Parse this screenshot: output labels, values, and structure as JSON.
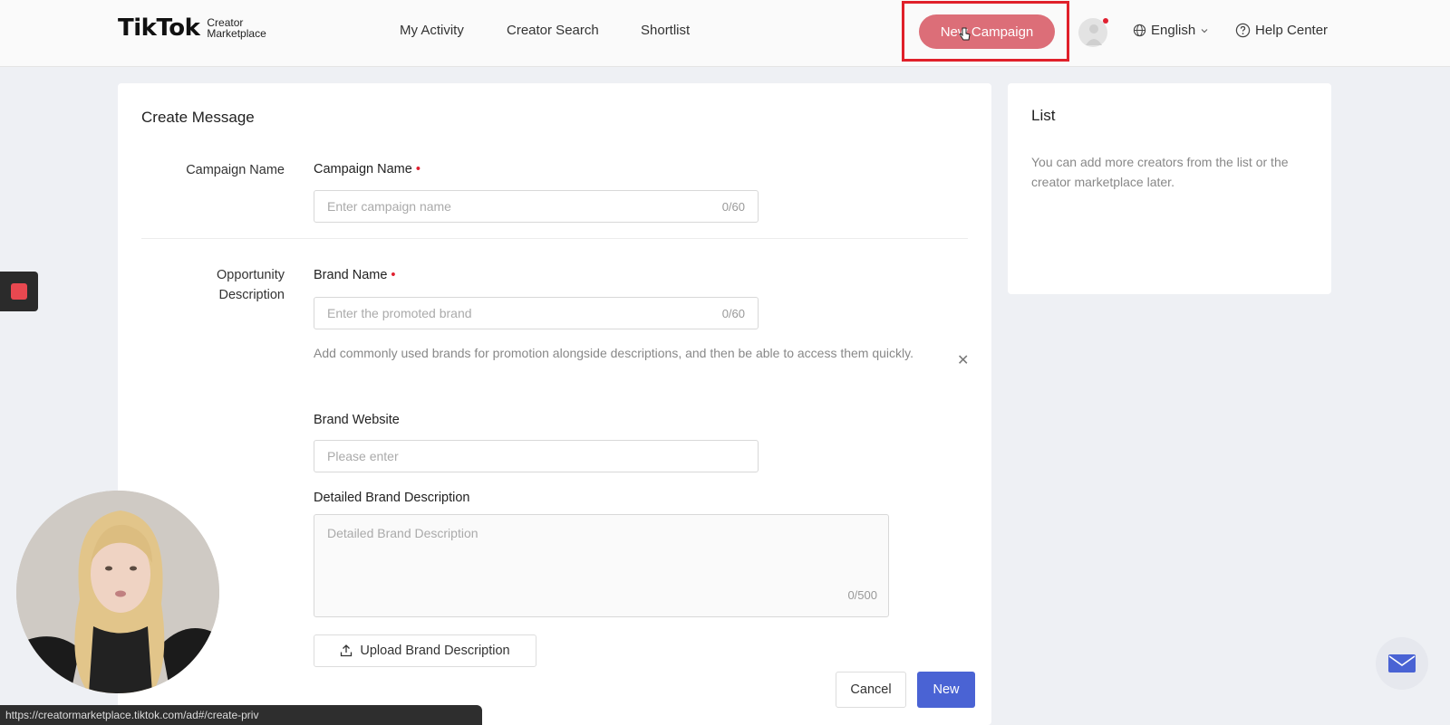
{
  "header": {
    "logo_main": "TikTok",
    "logo_sub_line1": "Creator",
    "logo_sub_line2": "Marketplace",
    "nav": [
      "My Activity",
      "Creator Search",
      "Shortlist"
    ],
    "new_campaign_label": "New Campaign",
    "language": "English",
    "help_label": "Help Center"
  },
  "form": {
    "title": "Create Message",
    "campaign_section_label": "Campaign Name",
    "campaign_name_label": "Campaign Name",
    "campaign_name_placeholder": "Enter campaign name",
    "campaign_name_counter": "0/60",
    "opportunity_label_line1": "Opportunity",
    "opportunity_label_line2": "Description",
    "brand_name_label": "Brand Name",
    "brand_name_placeholder": "Enter the promoted brand",
    "brand_name_counter": "0/60",
    "brand_hint": "Add commonly used brands for promotion alongside descriptions, and then be able to access them quickly.",
    "brand_website_label": "Brand Website",
    "brand_website_placeholder": "Please enter",
    "brand_description_label": "Detailed Brand Description",
    "brand_description_placeholder": "Detailed Brand Description",
    "brand_description_counter": "0/500",
    "upload_label": "Upload Brand Description",
    "cancel_label": "Cancel",
    "submit_label": "New"
  },
  "side": {
    "title": "List",
    "text": "You can add more creators from the list or the creator marketplace later."
  },
  "status_url": "https://creatormarketplace.tiktok.com/ad#/create-priv",
  "colors": {
    "accent_red": "#dc6e78",
    "highlight": "#e0202a",
    "primary_blue": "#4a63d4"
  }
}
